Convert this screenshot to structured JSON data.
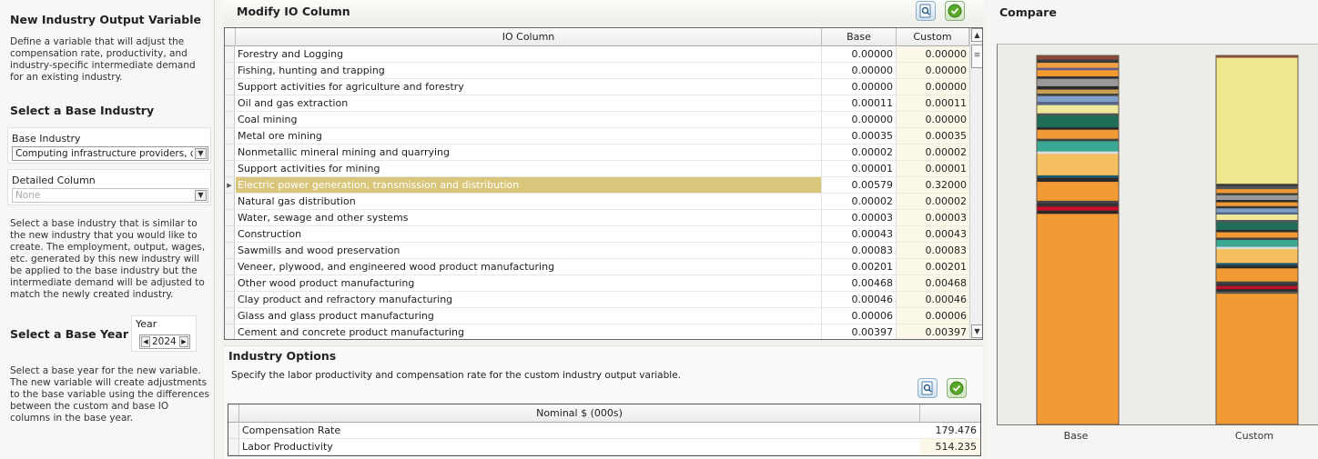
{
  "left": {
    "title": "New Industry Output Variable",
    "description": "Define a variable that will adjust the compensation rate, productivity, and industry-specific intermediate demand for an existing industry.",
    "base_industry_section_title": "Select a Base Industry",
    "base_industry_label": "Base Industry",
    "base_industry_value": "Computing infrastructure providers, data",
    "detailed_column_label": "Detailed Column",
    "detailed_column_value": "None",
    "base_industry_help": "Select a base industry that is similar to the new industry that you would like to create. The employment, output, wages, etc. generated by this new industry will be applied to the base industry but the intermediate demand will be adjusted to match the newly created industry.",
    "base_year_section_title": "Select a Base Year",
    "year_label": "Year",
    "year_value": "2024",
    "base_year_help": "Select a base year for the new variable. The new variable will create adjustments to the base variable using the differences between the custom and base IO columns in the base year."
  },
  "center": {
    "title": "Modify IO Column",
    "grid_headers": {
      "io_column": "IO Column",
      "base": "Base",
      "custom": "Custom"
    },
    "rows": [
      {
        "name": "Forestry and Logging",
        "base": "0.00000",
        "custom": "0.00000"
      },
      {
        "name": "Fishing, hunting and trapping",
        "base": "0.00000",
        "custom": "0.00000"
      },
      {
        "name": "Support activities for agriculture and forestry",
        "base": "0.00000",
        "custom": "0.00000"
      },
      {
        "name": "Oil and gas extraction",
        "base": "0.00011",
        "custom": "0.00011"
      },
      {
        "name": "Coal mining",
        "base": "0.00000",
        "custom": "0.00000"
      },
      {
        "name": "Metal ore mining",
        "base": "0.00035",
        "custom": "0.00035"
      },
      {
        "name": "Nonmetallic mineral mining and quarrying",
        "base": "0.00002",
        "custom": "0.00002"
      },
      {
        "name": "Support activities for mining",
        "base": "0.00001",
        "custom": "0.00001"
      },
      {
        "name": "Electric power generation, transmission and distribution",
        "base": "0.00579",
        "custom": "0.32000",
        "selected": true
      },
      {
        "name": "Natural gas distribution",
        "base": "0.00002",
        "custom": "0.00002"
      },
      {
        "name": "Water, sewage and other systems",
        "base": "0.00003",
        "custom": "0.00003"
      },
      {
        "name": "Construction",
        "base": "0.00043",
        "custom": "0.00043"
      },
      {
        "name": "Sawmills and wood preservation",
        "base": "0.00083",
        "custom": "0.00083"
      },
      {
        "name": "Veneer, plywood, and engineered wood product manufacturing",
        "base": "0.00201",
        "custom": "0.00201"
      },
      {
        "name": "Other wood product manufacturing",
        "base": "0.00468",
        "custom": "0.00468"
      },
      {
        "name": "Clay product and refractory manufacturing",
        "base": "0.00046",
        "custom": "0.00046"
      },
      {
        "name": "Glass and glass product manufacturing",
        "base": "0.00006",
        "custom": "0.00006"
      },
      {
        "name": "Cement and concrete product manufacturing",
        "base": "0.00397",
        "custom": "0.00397"
      }
    ],
    "industry_options_title": "Industry Options",
    "industry_options_desc": "Specify the labor productivity and compensation rate for the custom industry output variable.",
    "options_header": "Nominal $ (000s)",
    "options": [
      {
        "label": "Compensation Rate",
        "value": "179.476"
      },
      {
        "label": "Labor Productivity",
        "value": "514.235"
      }
    ],
    "icons": {
      "preview": "preview-icon",
      "confirm": "check-icon"
    }
  },
  "right": {
    "title": "Compare",
    "base_label": "Base",
    "custom_label": "Custom"
  },
  "chart_data": {
    "type": "bar",
    "stacked": true,
    "categories": [
      "Base",
      "Custom"
    ],
    "segments": {
      "Base": [
        {
          "v": 0.01,
          "c": "#8b4a3c"
        },
        {
          "v": 0.008,
          "c": "#3a3a3a"
        },
        {
          "v": 0.012,
          "c": "#f0a040"
        },
        {
          "v": 0.006,
          "c": "#6a5a8a"
        },
        {
          "v": 0.015,
          "c": "#f39a34"
        },
        {
          "v": 0.006,
          "c": "#333333"
        },
        {
          "v": 0.018,
          "c": "#9a9a9a"
        },
        {
          "v": 0.008,
          "c": "#2a2a2a"
        },
        {
          "v": 0.01,
          "c": "#c8a050"
        },
        {
          "v": 0.006,
          "c": "#444444"
        },
        {
          "v": 0.014,
          "c": "#7ea0c8"
        },
        {
          "v": 0.008,
          "c": "#556688"
        },
        {
          "v": 0.02,
          "c": "#f0e89a"
        },
        {
          "v": 0.006,
          "c": "#555555"
        },
        {
          "v": 0.028,
          "c": "#1e6e5a"
        },
        {
          "v": 0.006,
          "c": "#2d2d2d"
        },
        {
          "v": 0.022,
          "c": "#f29a34"
        },
        {
          "v": 0.006,
          "c": "#444444"
        },
        {
          "v": 0.025,
          "c": "#3aa892"
        },
        {
          "v": 0.006,
          "c": "#dddddd"
        },
        {
          "v": 0.052,
          "c": "#f6c060"
        },
        {
          "v": 0.006,
          "c": "#1e5a6e"
        },
        {
          "v": 0.01,
          "c": "#2c2c2c"
        },
        {
          "v": 0.008,
          "c": "#f29a34"
        },
        {
          "v": 0.038,
          "c": "#f29a34"
        },
        {
          "v": 0.006,
          "c": "#444444"
        },
        {
          "v": 0.008,
          "c": "#333333"
        },
        {
          "v": 0.01,
          "c": "#c0102a"
        },
        {
          "v": 0.008,
          "c": "#2a2a2a"
        },
        {
          "v": 0.513,
          "c": "#f29a34"
        }
      ],
      "Custom": [
        {
          "v": 0.006,
          "c": "#8b4a3c"
        },
        {
          "v": 0.328,
          "c": "#f0e88e"
        },
        {
          "v": 0.006,
          "c": "#3a3a3a"
        },
        {
          "v": 0.008,
          "c": "#555555"
        },
        {
          "v": 0.01,
          "c": "#f39a34"
        },
        {
          "v": 0.006,
          "c": "#444444"
        },
        {
          "v": 0.012,
          "c": "#9a9a9a"
        },
        {
          "v": 0.006,
          "c": "#2a2a2a"
        },
        {
          "v": 0.01,
          "c": "#f29a34"
        },
        {
          "v": 0.006,
          "c": "#3a3a3a"
        },
        {
          "v": 0.01,
          "c": "#7ea0c8"
        },
        {
          "v": 0.006,
          "c": "#556688"
        },
        {
          "v": 0.014,
          "c": "#f0e89a"
        },
        {
          "v": 0.006,
          "c": "#555555"
        },
        {
          "v": 0.02,
          "c": "#1e6e5a"
        },
        {
          "v": 0.006,
          "c": "#2d2d2d"
        },
        {
          "v": 0.014,
          "c": "#f29a34"
        },
        {
          "v": 0.006,
          "c": "#444444"
        },
        {
          "v": 0.018,
          "c": "#3aa892"
        },
        {
          "v": 0.006,
          "c": "#dddddd"
        },
        {
          "v": 0.036,
          "c": "#f6c060"
        },
        {
          "v": 0.006,
          "c": "#1e5a6e"
        },
        {
          "v": 0.008,
          "c": "#2c2c2c"
        },
        {
          "v": 0.034,
          "c": "#f29a34"
        },
        {
          "v": 0.006,
          "c": "#444444"
        },
        {
          "v": 0.006,
          "c": "#333333"
        },
        {
          "v": 0.008,
          "c": "#c0102a"
        },
        {
          "v": 0.006,
          "c": "#2a2a2a"
        },
        {
          "v": 0.006,
          "c": "#555555"
        },
        {
          "v": 0.34,
          "c": "#f29a34"
        }
      ]
    }
  }
}
